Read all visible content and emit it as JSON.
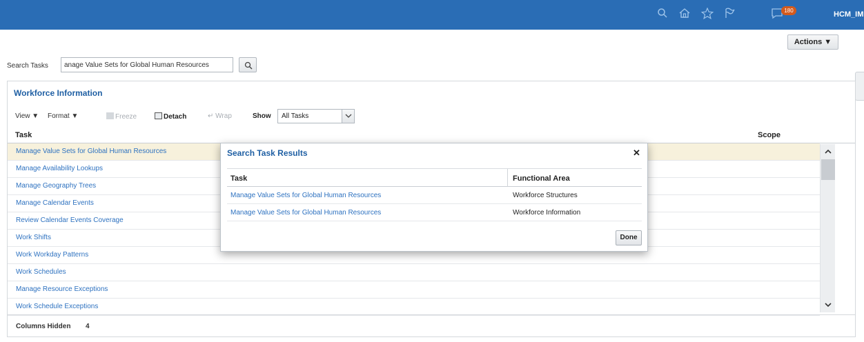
{
  "header": {
    "user_name": "HCM_IMPL",
    "notifications_count": "180",
    "icons": [
      "search-icon",
      "home-icon",
      "favorites-star-icon",
      "watchlist-flag-icon",
      "notifications-icon"
    ],
    "bar_color": "#2a6db5"
  },
  "actions": {
    "label": "Actions ▼"
  },
  "search": {
    "label": "Search Tasks",
    "value": "anage Value Sets for Global Human Resources"
  },
  "panel": {
    "title": "Workforce Information",
    "toolbar": {
      "view": "View ▼",
      "format": "Format ▼",
      "freeze": "Freeze",
      "detach": "Detach",
      "wrap": "Wrap",
      "show_label": "Show",
      "show_value": "All Tasks"
    },
    "columns": {
      "task": "Task",
      "scope": "Scope"
    },
    "rows": [
      "Manage Value Sets for Global Human Resources",
      "Manage Availability Lookups",
      "Manage Geography Trees",
      "Manage Calendar Events",
      "Review Calendar Events Coverage",
      "Work Shifts",
      "Work Workday Patterns",
      "Work Schedules",
      "Manage Resource Exceptions",
      "Work Schedule Exceptions"
    ],
    "footer": {
      "columns_hidden_label": "Columns Hidden",
      "columns_hidden_count": "4"
    }
  },
  "dialog": {
    "title": "Search Task Results",
    "columns": {
      "task": "Task",
      "functional_area": "Functional Area"
    },
    "rows": [
      {
        "task": "Manage Value Sets for Global Human Resources",
        "area": "Workforce Structures"
      },
      {
        "task": "Manage Value Sets for Global Human Resources",
        "area": "Workforce Information"
      }
    ],
    "done_label": "Done"
  },
  "colors": {
    "link": "#2e72c0",
    "title": "#1f5fa3",
    "selected_row": "#f7f1dc",
    "badge": "#d45a1c"
  }
}
